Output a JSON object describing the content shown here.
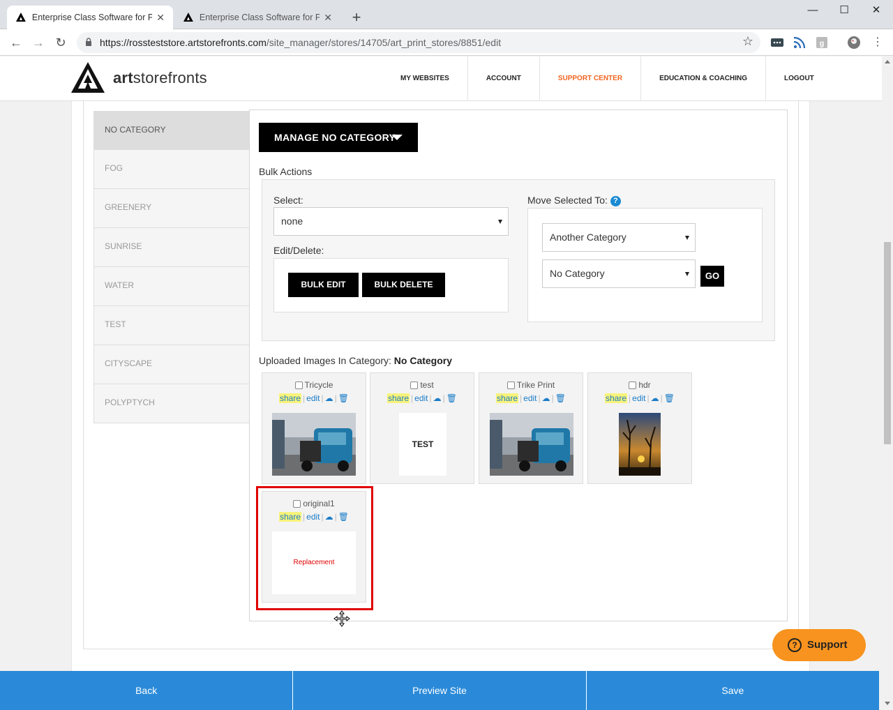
{
  "browser": {
    "tabs": [
      {
        "title": "Enterprise Class Software for Print",
        "active": true
      },
      {
        "title": "Enterprise Class Software for Print",
        "active": false
      }
    ],
    "url_host": "https://rossteststore.artstorefronts.com",
    "url_path": "/site_manager/stores/14705/art_print_stores/8851/edit"
  },
  "header": {
    "logo_bold": "art",
    "logo_rest": "storefronts",
    "nav": [
      "MY WEBSITES",
      "ACCOUNT",
      "SUPPORT CENTER",
      "EDUCATION & COACHING",
      "LOGOUT"
    ]
  },
  "categories": [
    "NO CATEGORY",
    "FOG",
    "GREENERY",
    "SUNRISE",
    "WATER",
    "TEST",
    "CITYSCAPE",
    "POLYPTYCH"
  ],
  "manage": {
    "button_label": "MANAGE NO CATEGORY",
    "bulk_actions_title": "Bulk Actions",
    "select_label": "Select:",
    "select_value": "none",
    "edit_delete_label": "Edit/Delete:",
    "bulk_edit": "BULK EDIT",
    "bulk_delete": "BULK DELETE",
    "move_label": "Move Selected To:",
    "move_type_value": "Another Category",
    "move_target_value": "No Category",
    "go_label": "GO"
  },
  "uploaded": {
    "prefix": "Uploaded Images In Category: ",
    "category": "No Category",
    "link_share": "share",
    "link_edit": "edit",
    "images": [
      {
        "name": "Tricycle",
        "thumb": "photo-trike"
      },
      {
        "name": "test",
        "thumb_text": "TEST"
      },
      {
        "name": "Trike Print",
        "thumb": "photo-trike"
      },
      {
        "name": "hdr",
        "thumb": "photo-sunset"
      },
      {
        "name": "original1",
        "thumb_text": "Replacement"
      }
    ]
  },
  "footer": {
    "back": "Back",
    "preview": "Preview Site",
    "save": "Save"
  },
  "support_label": "Support",
  "colors": {
    "accent_blue": "#2a8ad9",
    "support_orange": "#f7931e",
    "highlight_red": "#e00000",
    "nav_support": "#f26522"
  }
}
